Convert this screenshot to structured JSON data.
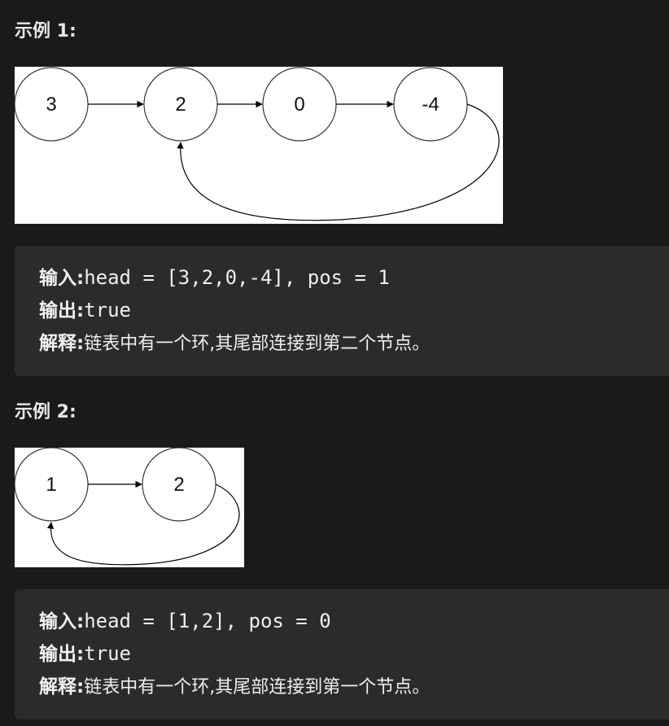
{
  "example1": {
    "heading": "示例 1:",
    "nodes": [
      "3",
      "2",
      "0",
      "-4"
    ],
    "input_label": "输入:",
    "input_value": "head = [3,2,0,-4], pos = 1",
    "output_label": "输出:",
    "output_value": "true",
    "explain_label": "解释:",
    "explain_value": "链表中有一个环,其尾部连接到第二个节点。"
  },
  "example2": {
    "heading": "示例 2:",
    "nodes": [
      "1",
      "2"
    ],
    "input_label": "输入:",
    "input_value": "head = [1,2], pos = 0",
    "output_label": "输出:",
    "output_value": "true",
    "explain_label": "解释:",
    "explain_value": "链表中有一个环,其尾部连接到第一个节点。"
  }
}
